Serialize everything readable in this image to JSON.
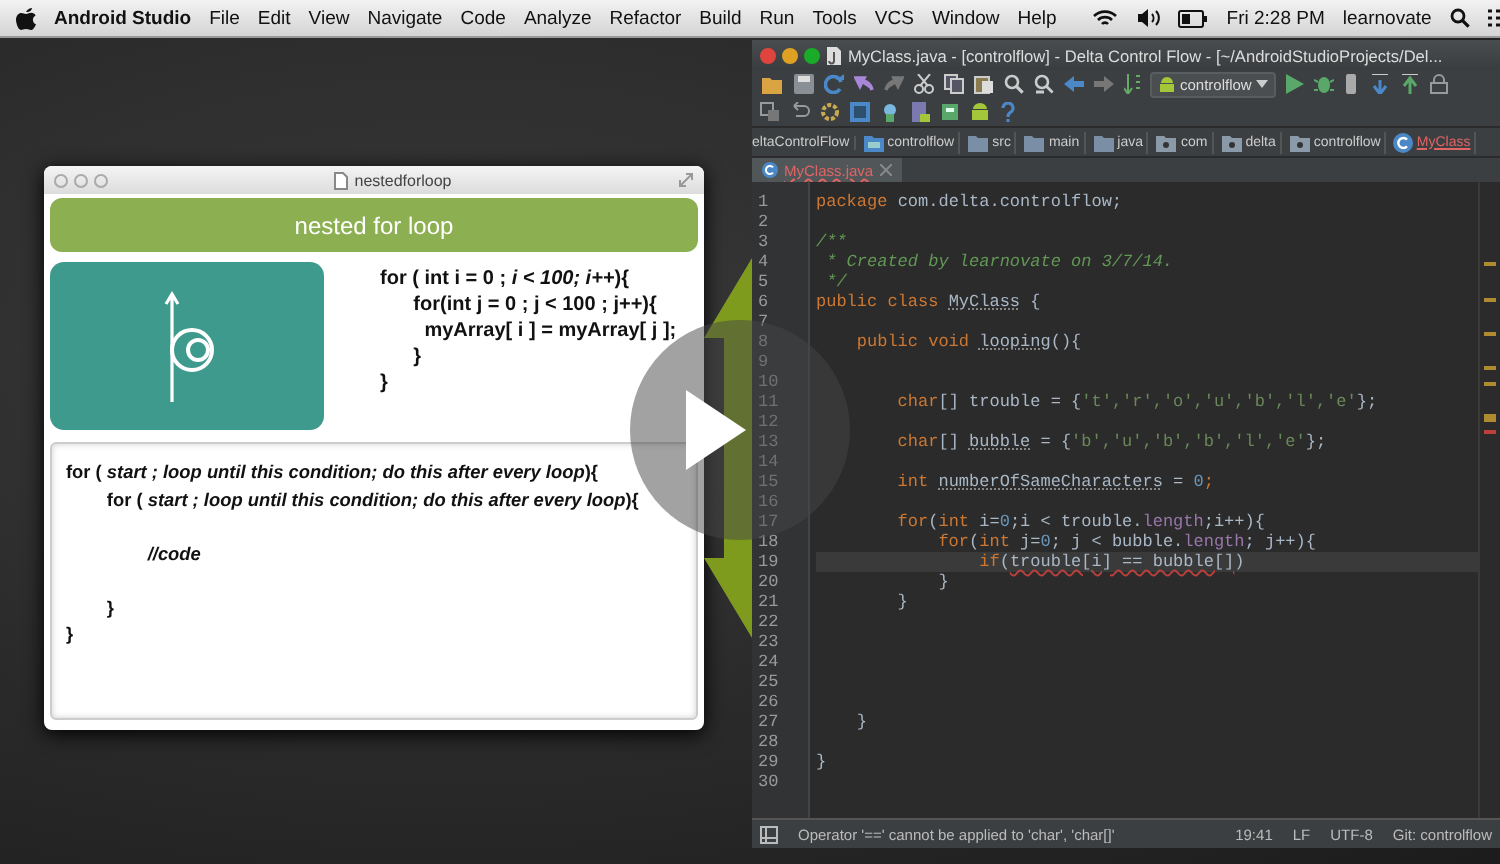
{
  "menu_bar": {
    "app_name": "Android Studio",
    "menus": [
      "File",
      "Edit",
      "View",
      "Navigate",
      "Code",
      "Analyze",
      "Refactor",
      "Build",
      "Run",
      "Tools",
      "VCS",
      "Window",
      "Help"
    ],
    "clock": "Fri 2:28 PM",
    "user": "learnovate"
  },
  "slide_window": {
    "title": "nestedforloop",
    "heading": "nested for loop",
    "snippet_lines": [
      "for ( int i = 0 ; *i < 100; i++*){",
      "      for(int j = 0 ; j < 100 ; j++){",
      "        myArray[ i ] = myArray[ j ];",
      "      }",
      "}"
    ],
    "syntax_lines": [
      {
        "text": "for ( *start ; loop until this condition; do this after every loop*){",
        "space_before": false
      },
      {
        "text": "        for ( *start ; loop until this condition; do this after every loop*){",
        "space_before": false
      },
      {
        "text": "                *//code*",
        "space_before": true
      },
      {
        "text": "        }",
        "space_before": true
      },
      {
        "text": "}",
        "space_before": false
      }
    ]
  },
  "ide_window": {
    "title": "MyClass.java - [controlflow] - Delta Control Flow - [~/AndroidStudioProjects/Del...",
    "run_config": "controlflow",
    "breadcrumbs": [
      {
        "kind": "project",
        "label": "eltaControlFlow"
      },
      {
        "kind": "module",
        "label": "controlflow"
      },
      {
        "kind": "folder",
        "label": "src"
      },
      {
        "kind": "folder",
        "label": "main"
      },
      {
        "kind": "folder",
        "label": "java"
      },
      {
        "kind": "package",
        "label": "com"
      },
      {
        "kind": "package",
        "label": "delta"
      },
      {
        "kind": "package",
        "label": "controlflow"
      },
      {
        "kind": "class",
        "label": "MyClass"
      }
    ],
    "tabs": [
      {
        "label": "MyClass.java",
        "selected": true
      }
    ],
    "code_lines": [
      {
        "number": "1",
        "current": false,
        "tokens": [
          {
            "kind": "keyword",
            "text": "package"
          },
          {
            "kind": "plain",
            "text": " com.delta.controlflow;"
          }
        ]
      },
      {
        "number": "2",
        "current": false
      },
      {
        "number": "3",
        "current": false,
        "tokens": [
          {
            "kind": "comment",
            "text": "/**"
          }
        ]
      },
      {
        "number": "4",
        "current": false,
        "tokens": [
          {
            "kind": "comment",
            "text": " * Created by learnovate on 3/7/14."
          }
        ]
      },
      {
        "number": "5",
        "current": false,
        "tokens": [
          {
            "kind": "comment",
            "text": " */"
          }
        ]
      },
      {
        "number": "6",
        "current": false,
        "tokens": [
          {
            "kind": "keyword",
            "text": "public class "
          },
          {
            "kind": "unused",
            "text": "MyClass"
          },
          {
            "kind": "plain",
            "text": " {"
          }
        ]
      },
      {
        "number": "7",
        "current": false
      },
      {
        "number": "8",
        "current": false,
        "tokens": [
          {
            "kind": "keyword",
            "text": "    public void "
          },
          {
            "kind": "unused",
            "text": "looping"
          },
          {
            "kind": "plain",
            "text": "(){"
          }
        ]
      },
      {
        "number": "9",
        "current": false
      },
      {
        "number": "10",
        "current": false
      },
      {
        "number": "11",
        "current": false,
        "tokens": [
          {
            "kind": "keyword",
            "text": "        char"
          },
          {
            "kind": "plain",
            "text": "[] trouble = {"
          },
          {
            "kind": "string",
            "text": "'t','r','o','u','b','l','e'"
          },
          {
            "kind": "plain",
            "text": "};"
          }
        ]
      },
      {
        "number": "12",
        "current": false
      },
      {
        "number": "13",
        "current": false,
        "tokens": [
          {
            "kind": "keyword",
            "text": "        char"
          },
          {
            "kind": "plain",
            "text": "[] "
          },
          {
            "kind": "unused",
            "text": "bubble"
          },
          {
            "kind": "plain",
            "text": " = {"
          },
          {
            "kind": "string",
            "text": "'b','u','b','b','l','e'"
          },
          {
            "kind": "plain",
            "text": "};"
          }
        ]
      },
      {
        "number": "14",
        "current": false
      },
      {
        "number": "15",
        "current": false,
        "tokens": [
          {
            "kind": "keyword",
            "text": "        int "
          },
          {
            "kind": "unused",
            "text": "numberOfSameCharacters"
          },
          {
            "kind": "plain",
            "text": " = "
          },
          {
            "kind": "number",
            "text": "0"
          },
          {
            "kind": "keyword",
            "text": ";"
          }
        ]
      },
      {
        "number": "16",
        "current": false
      },
      {
        "number": "17",
        "current": false,
        "tokens": [
          {
            "kind": "keyword",
            "text": "        for"
          },
          {
            "kind": "plain",
            "text": "("
          },
          {
            "kind": "keyword",
            "text": "int "
          },
          {
            "kind": "plain",
            "text": "i="
          },
          {
            "kind": "number",
            "text": "0"
          },
          {
            "kind": "plain",
            "text": ";i < trouble."
          },
          {
            "kind": "field",
            "text": "length"
          },
          {
            "kind": "plain",
            "text": ";i++){"
          }
        ]
      },
      {
        "number": "18",
        "current": false,
        "tokens": [
          {
            "kind": "keyword",
            "text": "            for"
          },
          {
            "kind": "plain",
            "text": "("
          },
          {
            "kind": "keyword",
            "text": "int "
          },
          {
            "kind": "plain",
            "text": "j="
          },
          {
            "kind": "number",
            "text": "0"
          },
          {
            "kind": "plain",
            "text": "; j < bubble."
          },
          {
            "kind": "field",
            "text": "length"
          },
          {
            "kind": "plain",
            "text": "; j++){"
          }
        ]
      },
      {
        "number": "19",
        "current": true,
        "tokens": [
          {
            "kind": "keyword",
            "text": "                if"
          },
          {
            "kind": "plain",
            "text": "("
          },
          {
            "kind": "error",
            "text": "trouble[i] == bubble[]"
          },
          {
            "kind": "plain",
            "text": ")"
          }
        ]
      },
      {
        "number": "20",
        "current": false,
        "tokens": [
          {
            "kind": "plain",
            "text": "            }"
          }
        ]
      },
      {
        "number": "21",
        "current": false,
        "tokens": [
          {
            "kind": "plain",
            "text": "        }"
          }
        ]
      },
      {
        "number": "22",
        "current": false
      },
      {
        "number": "23",
        "current": false
      },
      {
        "number": "24",
        "current": false
      },
      {
        "number": "25",
        "current": false
      },
      {
        "number": "26",
        "current": false
      },
      {
        "number": "27",
        "current": false,
        "tokens": [
          {
            "kind": "plain",
            "text": "    }"
          }
        ]
      },
      {
        "number": "28",
        "current": false
      },
      {
        "number": "29",
        "current": false,
        "tokens": [
          {
            "kind": "plain",
            "text": "}"
          }
        ]
      },
      {
        "number": "30",
        "current": false
      }
    ],
    "status_bar": {
      "message": "Operator '==' cannot be applied to 'char', 'char[]'",
      "position": "19:41",
      "line_separator": "LF",
      "encoding": "UTF-8",
      "vcs": "Git: controlflow"
    }
  }
}
